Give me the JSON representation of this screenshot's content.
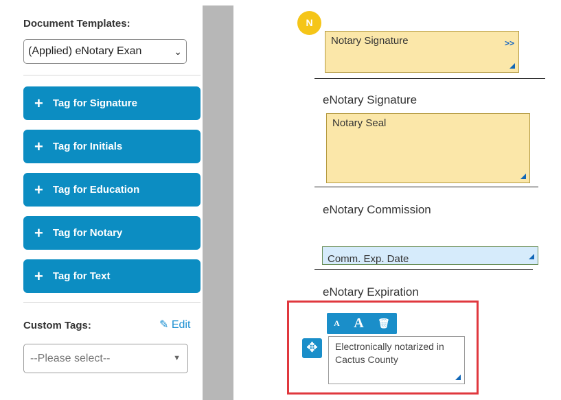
{
  "sidebar": {
    "templates_label": "Document Templates:",
    "template_select_value": "(Applied) eNotary Exan",
    "tag_buttons": [
      {
        "label": "Tag for Signature"
      },
      {
        "label": "Tag for Initials"
      },
      {
        "label": "Tag for Education"
      },
      {
        "label": "Tag for Notary"
      },
      {
        "label": "Tag for Text"
      }
    ],
    "custom_tags_label": "Custom Tags:",
    "edit_label": "Edit",
    "custom_select_placeholder": "--Please select--"
  },
  "document": {
    "badge_letter": "N",
    "notary_signature_field": "Notary Signature",
    "expand_arrows": ">>",
    "enotary_signature_label": "eNotary Signature",
    "notary_seal_field": "Notary Seal",
    "enotary_commission_label": "eNotary Commission",
    "comm_exp_date_field": "Comm. Exp. Date",
    "enotary_expiration_label": "eNotary Expiration",
    "text_tag": {
      "toolbar_small_font": "A",
      "toolbar_large_font": "A",
      "text_value": "Electronically notarized in Cactus County"
    }
  },
  "colors": {
    "accent_blue": "#0c8dc2",
    "field_yellow": "#fbe7a9",
    "field_blue": "#d6ebfb",
    "badge_yellow": "#f5c518",
    "highlight_red": "#e0383e"
  }
}
